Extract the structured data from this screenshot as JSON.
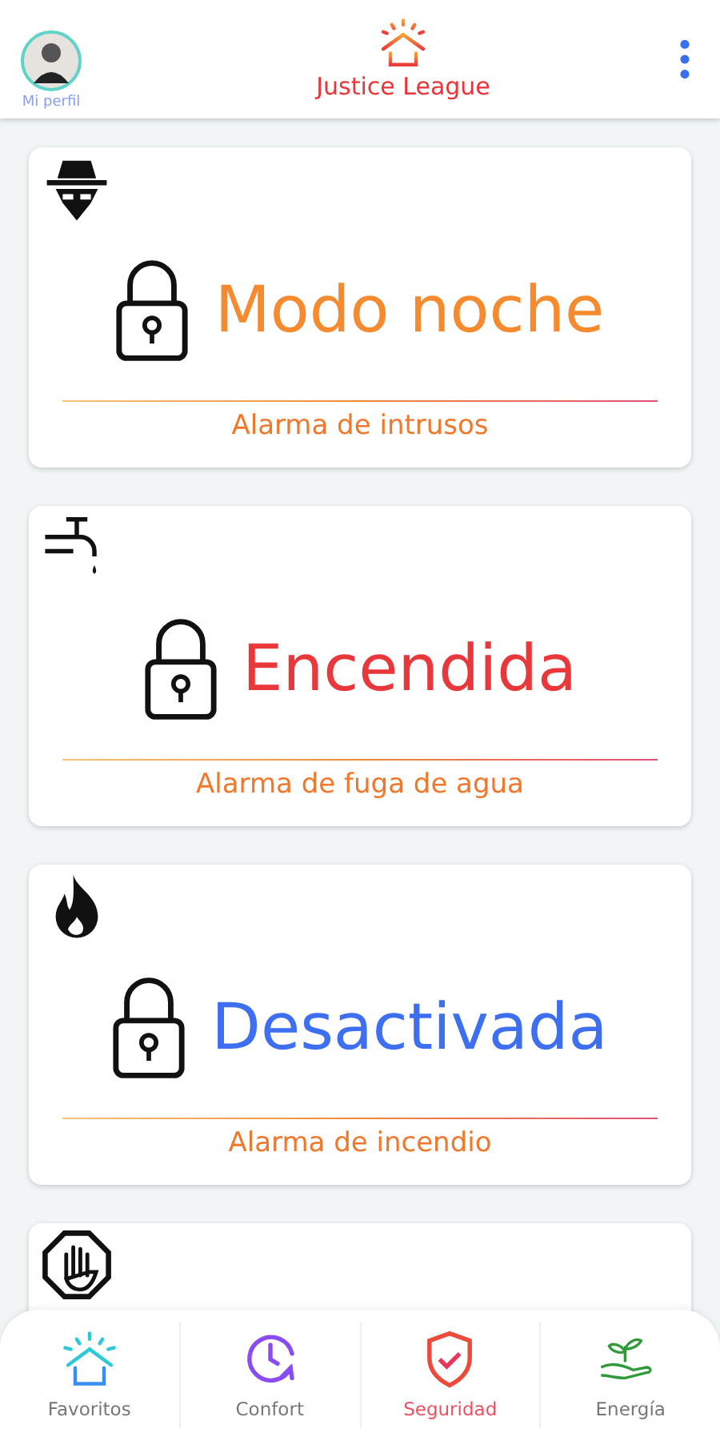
{
  "header": {
    "profile_label": "Mi perfil",
    "title": "Justice League"
  },
  "cards": [
    {
      "kind": "spy",
      "status": "Modo noche",
      "color": "#f58a2e",
      "label": "Alarma de intrusos"
    },
    {
      "kind": "faucet",
      "status": "Encendida",
      "color": "#e8383b",
      "label": "Alarma de fuga de agua"
    },
    {
      "kind": "fire",
      "status": "Desactivada",
      "color": "#3d6ff0",
      "label": "Alarma de incendio"
    },
    {
      "kind": "stop"
    }
  ],
  "nav": [
    {
      "kind": "home",
      "label": "Favoritos",
      "selected": false
    },
    {
      "kind": "clock",
      "label": "Confort",
      "selected": false
    },
    {
      "kind": "shield",
      "label": "Seguridad",
      "selected": true
    },
    {
      "kind": "plant",
      "label": "Energía",
      "selected": false
    }
  ]
}
